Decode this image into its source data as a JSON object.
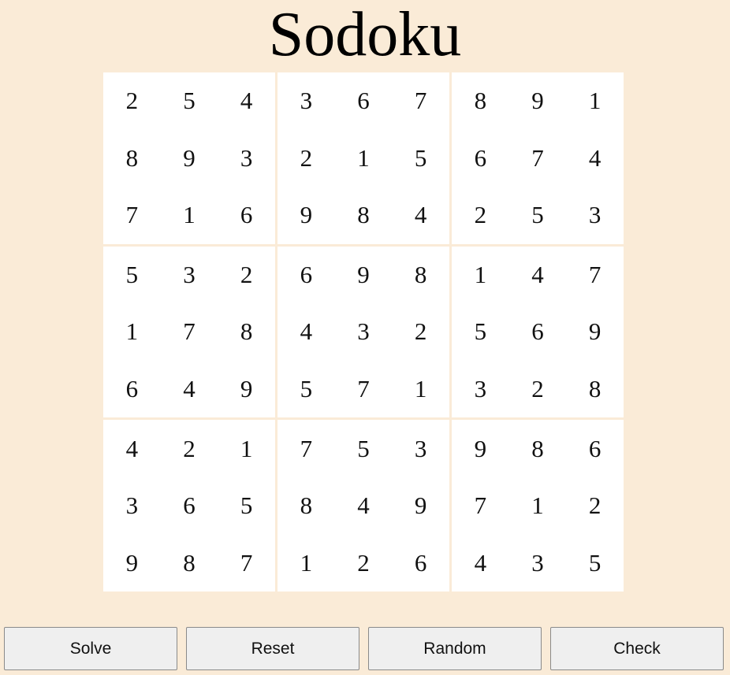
{
  "title": "Sodoku",
  "board": {
    "rows": [
      [
        "2",
        "5",
        "4",
        "3",
        "6",
        "7",
        "8",
        "9",
        "1"
      ],
      [
        "8",
        "9",
        "3",
        "2",
        "1",
        "5",
        "6",
        "7",
        "4"
      ],
      [
        "7",
        "1",
        "6",
        "9",
        "8",
        "4",
        "2",
        "5",
        "3"
      ],
      [
        "5",
        "3",
        "2",
        "6",
        "9",
        "8",
        "1",
        "4",
        "7"
      ],
      [
        "1",
        "7",
        "8",
        "4",
        "3",
        "2",
        "5",
        "6",
        "9"
      ],
      [
        "6",
        "4",
        "9",
        "5",
        "7",
        "1",
        "3",
        "2",
        "8"
      ],
      [
        "4",
        "2",
        "1",
        "7",
        "5",
        "3",
        "9",
        "8",
        "6"
      ],
      [
        "3",
        "6",
        "5",
        "8",
        "4",
        "9",
        "7",
        "1",
        "2"
      ],
      [
        "9",
        "8",
        "7",
        "1",
        "2",
        "6",
        "4",
        "3",
        "5"
      ]
    ]
  },
  "buttons": {
    "solve": "Solve",
    "reset": "Reset",
    "random": "Random",
    "check": "Check"
  },
  "colors": {
    "background": "#faebd7",
    "board": "#ffffff",
    "button": "#efefef"
  }
}
